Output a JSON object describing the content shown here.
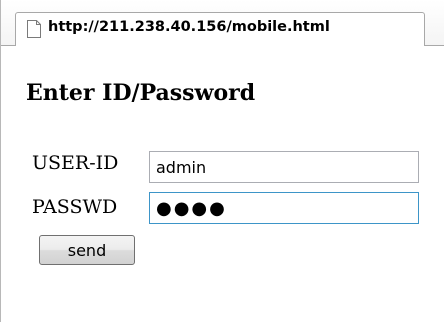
{
  "tab": {
    "url": "http://211.238.40.156/mobile.html",
    "icon": "page-icon"
  },
  "page": {
    "heading": "Enter ID/Password",
    "user_label": "USER-ID",
    "user_value": "admin",
    "pass_label": "PASSWD",
    "pass_value": "●●●●",
    "send_label": "send"
  },
  "colors": {
    "focus_border": "#3d95c8",
    "input_border": "#abadb3"
  }
}
